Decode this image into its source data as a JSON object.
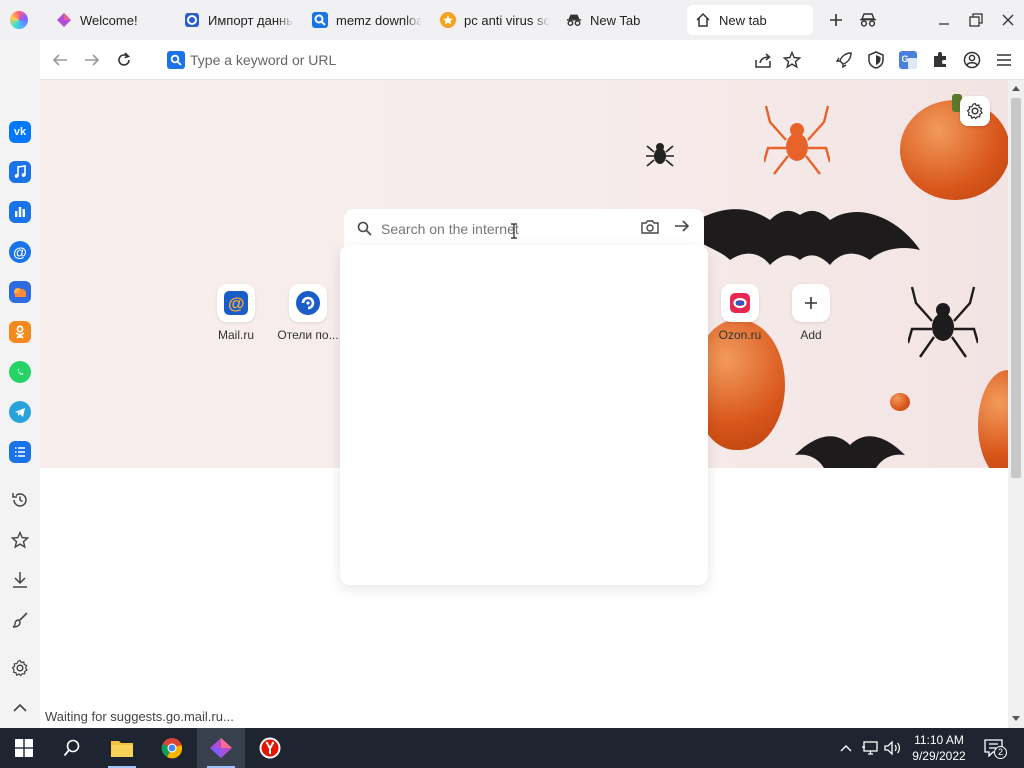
{
  "tabs": [
    {
      "title": "Welcome!"
    },
    {
      "title": "Импорт данных"
    },
    {
      "title": "memz download"
    },
    {
      "title": "pc anti virus soft"
    },
    {
      "title": "New Tab"
    },
    {
      "title": "New tab",
      "active": true
    }
  ],
  "toolbar": {
    "url_placeholder": "Type a keyword or URL"
  },
  "sidebar": {
    "apps": [
      "vk",
      "music",
      "statistics",
      "mail",
      "cloud",
      "ok",
      "whatsapp",
      "telegram",
      "tasks"
    ],
    "tools": [
      "history",
      "bookmarks",
      "downloads",
      "customize",
      "settings",
      "collapse"
    ]
  },
  "search": {
    "placeholder": "Search on the internet"
  },
  "speed_dial": [
    {
      "label": "Mail.ru"
    },
    {
      "label": "Отели по..."
    },
    {
      "label": "Ozon.ru"
    },
    {
      "label": "Add"
    }
  ],
  "status_text": "Waiting for suggests.go.mail.ru...",
  "clock": {
    "time": "11:10 AM",
    "date": "9/29/2022"
  },
  "notifications": {
    "count": "2"
  },
  "colors": {
    "accent": "#1a73e8",
    "vk": "#0077ff",
    "taskbar": "#1f2530"
  }
}
